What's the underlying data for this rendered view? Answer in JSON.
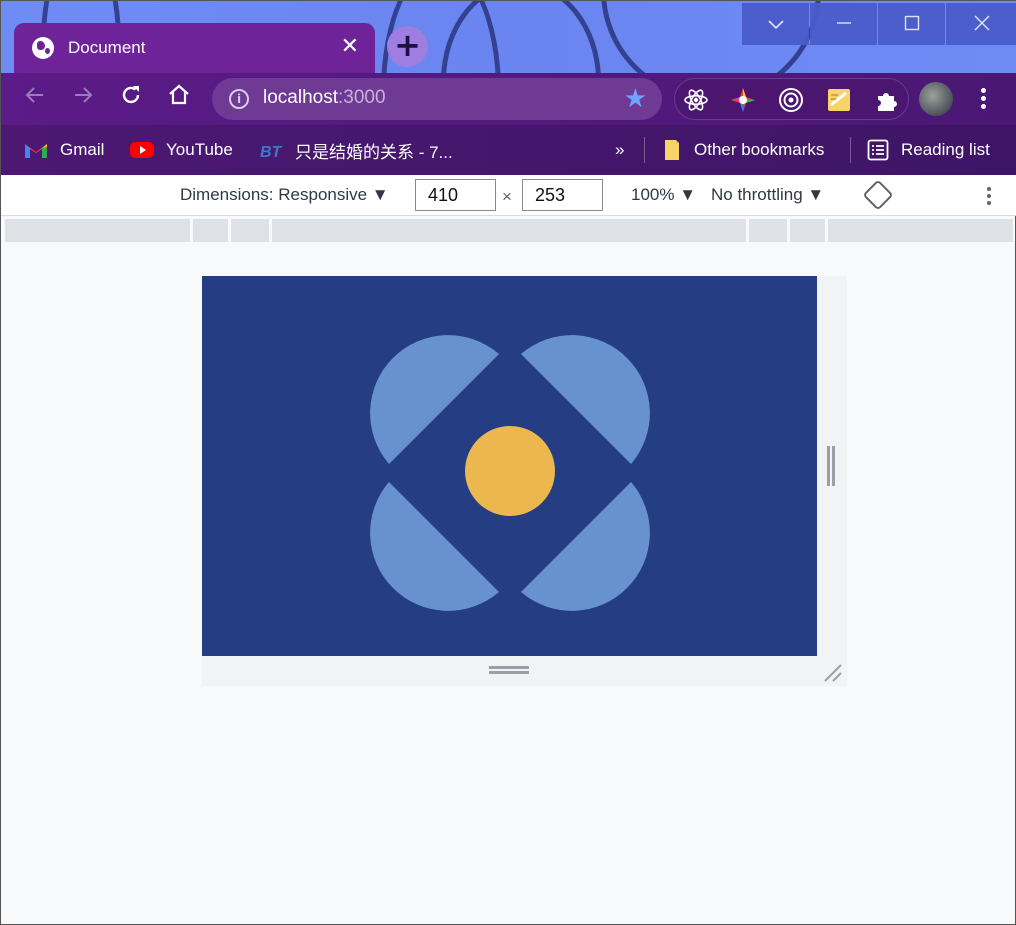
{
  "browser": {
    "tab": {
      "title": "Document",
      "close_glyph": "✕",
      "favicon": "globe-icon"
    },
    "new_tab_glyph": "+",
    "window_controls": {
      "dropdown": "⌄",
      "minimize": "—",
      "maximize": "☐",
      "close": "✕"
    },
    "nav": {
      "back": "←",
      "forward": "→",
      "reload": "↻",
      "home": "⌂"
    },
    "address": {
      "host": "localhost",
      "port": ":3000",
      "info_glyph": "i",
      "bookmark_star": "★"
    },
    "extensions": [
      "react-devtools-icon",
      "color-picker-icon",
      "target-icon",
      "notes-icon",
      "puzzle-icon"
    ],
    "bookmarks": [
      {
        "label": "Gmail",
        "icon": "gmail-icon"
      },
      {
        "label": "YouTube",
        "icon": "youtube-icon"
      },
      {
        "label": "只是结婚的关系 - 7...",
        "icon": "bt-icon"
      }
    ],
    "bookmarks_overflow": "»",
    "other_bookmarks": "Other bookmarks",
    "reading_list": "Reading list"
  },
  "devtools": {
    "dimensions_label": "Dimensions: Responsive ▼",
    "width": "410",
    "times": "×",
    "height": "253",
    "zoom": "100% ▼",
    "throttling": "No throttling ▼"
  },
  "page": {
    "background": "#253d82",
    "petal_color": "#6892cf",
    "center_color": "#edb74f"
  }
}
